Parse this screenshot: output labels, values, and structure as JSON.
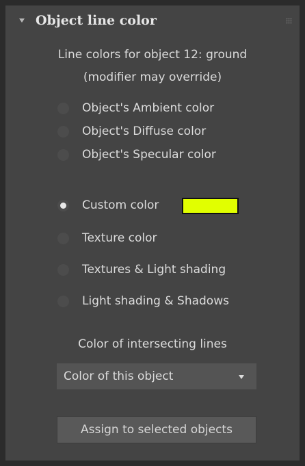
{
  "rollout": {
    "title": "Object line color"
  },
  "info": {
    "line1": "Line colors for object 12: ground",
    "line2": "(modifier may override)"
  },
  "options": [
    {
      "label": "Object's Ambient color",
      "checked": false
    },
    {
      "label": "Object's Diffuse color",
      "checked": false
    },
    {
      "label": "Object's Specular color",
      "checked": false
    },
    {
      "label": "Custom color",
      "checked": true
    },
    {
      "label": "Texture color",
      "checked": false
    },
    {
      "label": "Textures & Light shading",
      "checked": false
    },
    {
      "label": "Light shading & Shadows",
      "checked": false
    }
  ],
  "custom_color": {
    "swatch": "#e1ff00"
  },
  "intersecting": {
    "label": "Color of intersecting lines",
    "selected": "Color of this object"
  },
  "assign_button": {
    "label": "Assign to selected objects"
  }
}
